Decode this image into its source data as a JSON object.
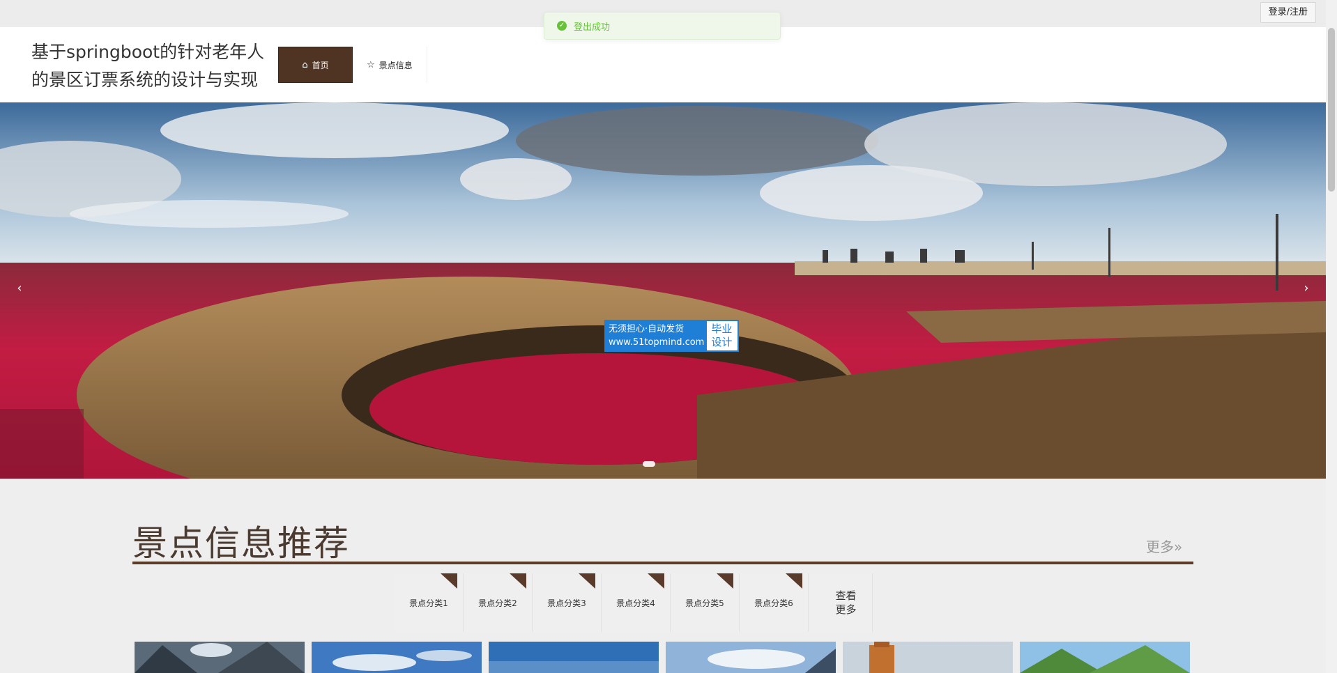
{
  "topbar": {
    "login_label": "登录/注册"
  },
  "toast": {
    "message": "登出成功",
    "icon": "check-circle-icon"
  },
  "header": {
    "site_title": "基于springboot的针对老年人的景区订票系统的设计与实现",
    "nav": [
      {
        "label": "首页",
        "icon": "home-icon",
        "active": true
      },
      {
        "label": "景点信息",
        "icon": "star-icon",
        "active": false
      }
    ]
  },
  "banner": {
    "prev_icon": "chevron-left-icon",
    "next_icon": "chevron-right-icon",
    "watermark_left_line1": "无须担心·自动发货",
    "watermark_left_line2": "www.51topmind.com",
    "watermark_right": "毕业设计"
  },
  "recommend": {
    "title": "景点信息推荐",
    "more_label": "更多»",
    "categories": [
      "景点分类1",
      "景点分类2",
      "景点分类3",
      "景点分类4",
      "景点分类5",
      "景点分类6"
    ],
    "see_more": "查看更多"
  },
  "colors": {
    "accent": "#4f3423",
    "toast_success": "#67c23a",
    "section_line": "#5c3b28"
  }
}
